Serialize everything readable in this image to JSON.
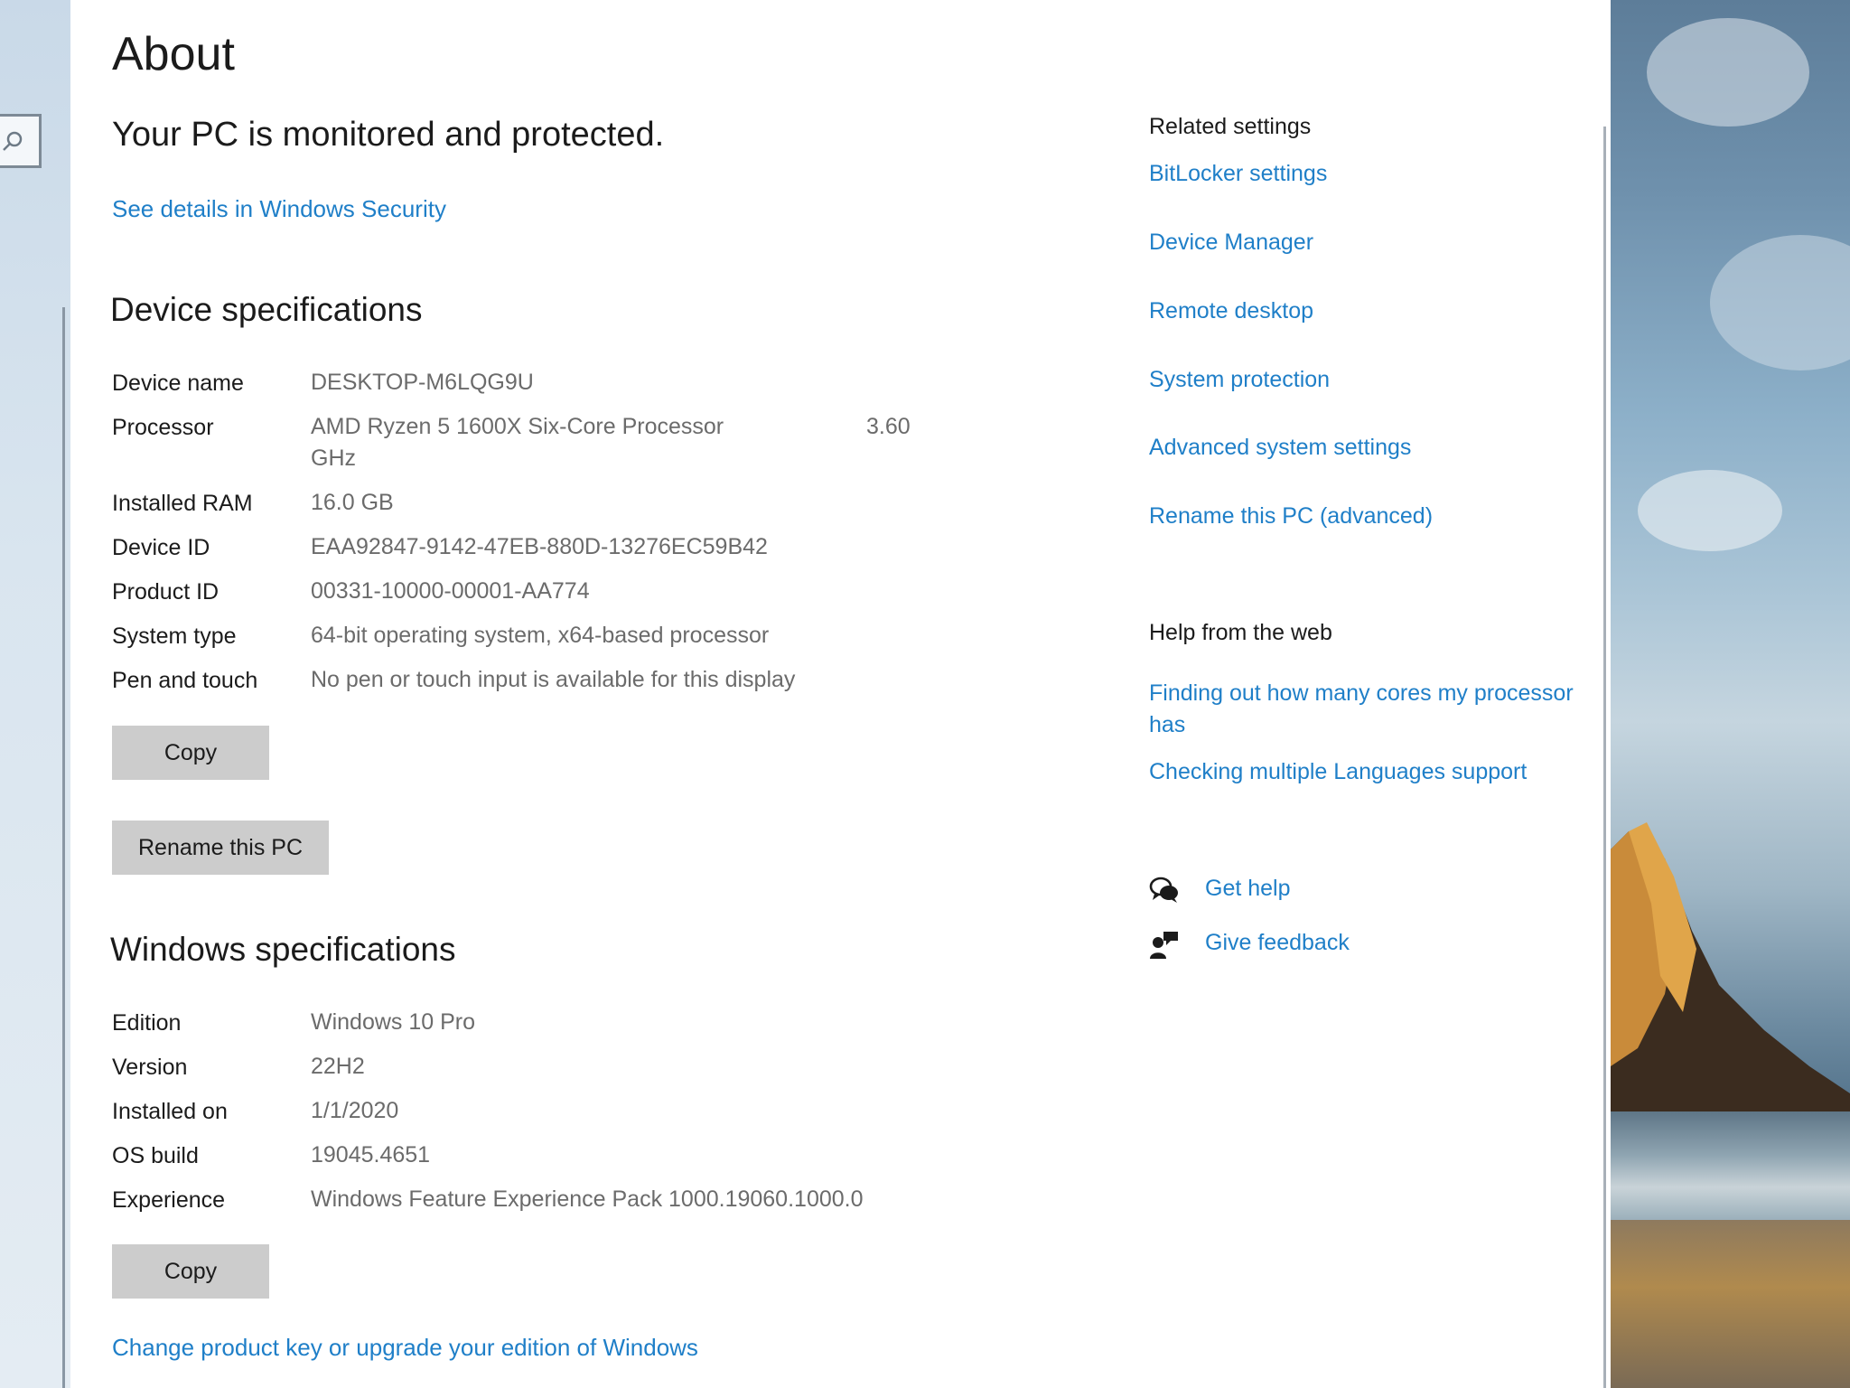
{
  "window": {
    "title": "About",
    "protection_status": "Your PC is monitored and protected.",
    "security_link": "See details in Windows Security"
  },
  "device_specs": {
    "title": "Device specifications",
    "rows": [
      {
        "label": "Device name",
        "value": "DESKTOP-M6LQG9U"
      },
      {
        "label": "Processor",
        "value": "AMD Ryzen 5 1600X Six-Core Processor",
        "value_extra": "3.60",
        "value_line2": "GHz"
      },
      {
        "label": "Installed RAM",
        "value": "16.0 GB"
      },
      {
        "label": "Device ID",
        "value": "EAA92847-9142-47EB-880D-13276EC59B42"
      },
      {
        "label": "Product ID",
        "value": "00331-10000-00001-AA774"
      },
      {
        "label": "System type",
        "value": "64-bit operating system, x64-based processor"
      },
      {
        "label": "Pen and touch",
        "value": "No pen or touch input is available for this display"
      }
    ],
    "copy_label": "Copy",
    "rename_label": "Rename this PC"
  },
  "windows_specs": {
    "title": "Windows specifications",
    "rows": [
      {
        "label": "Edition",
        "value": "Windows 10 Pro"
      },
      {
        "label": "Version",
        "value": "22H2"
      },
      {
        "label": "Installed on",
        "value": "1/1/2020"
      },
      {
        "label": "OS build",
        "value": "19045.4651"
      },
      {
        "label": "Experience",
        "value": "Windows Feature Experience Pack 1000.19060.1000.0"
      }
    ],
    "copy_label": "Copy",
    "upgrade_link": "Change product key or upgrade your edition of Windows"
  },
  "related_settings": {
    "title": "Related settings",
    "links": [
      "BitLocker settings",
      "Device Manager",
      "Remote desktop",
      "System protection",
      "Advanced system settings",
      "Rename this PC (advanced)"
    ]
  },
  "help_web": {
    "title": "Help from the web",
    "links": [
      "Finding out how many cores my processor has",
      "Checking multiple Languages support"
    ]
  },
  "support": {
    "get_help": "Get help",
    "give_feedback": "Give feedback"
  },
  "colors": {
    "accent_link": "#1f7fc8",
    "button_bg": "#cccccc",
    "value_text": "#6b6b6b"
  },
  "icons": [
    "search-icon",
    "get-help-icon",
    "give-feedback-icon"
  ]
}
